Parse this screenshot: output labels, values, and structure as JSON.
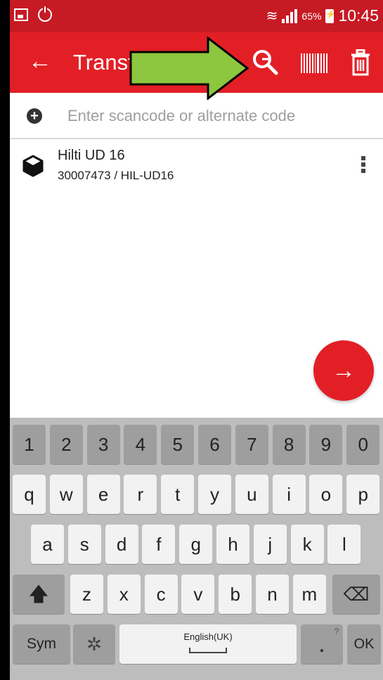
{
  "status_bar": {
    "battery": "65%",
    "time": "10:45"
  },
  "toolbar": {
    "title": "Transf"
  },
  "scan_field": {
    "placeholder": "Enter scancode or alternate code",
    "value": ""
  },
  "items": [
    {
      "name": "Hilti UD 16",
      "code": "30007473 / HIL-UD16"
    }
  ],
  "fab": {
    "icon": "→"
  },
  "keyboard": {
    "numbers": [
      "1",
      "2",
      "3",
      "4",
      "5",
      "6",
      "7",
      "8",
      "9",
      "0"
    ],
    "row1": [
      "q",
      "w",
      "e",
      "r",
      "t",
      "y",
      "u",
      "i",
      "o",
      "p"
    ],
    "row2": [
      "a",
      "s",
      "d",
      "f",
      "g",
      "h",
      "j",
      "k",
      "l"
    ],
    "row3": [
      "z",
      "x",
      "c",
      "v",
      "b",
      "n",
      "m"
    ],
    "sym": "Sym",
    "space_label": "English(UK)",
    "period": ".",
    "period_hint": "?",
    "ok": "OK"
  },
  "colors": {
    "primary": "#e31f26",
    "status_bar": "#c61a24",
    "highlight_arrow": "#8dc63f"
  }
}
